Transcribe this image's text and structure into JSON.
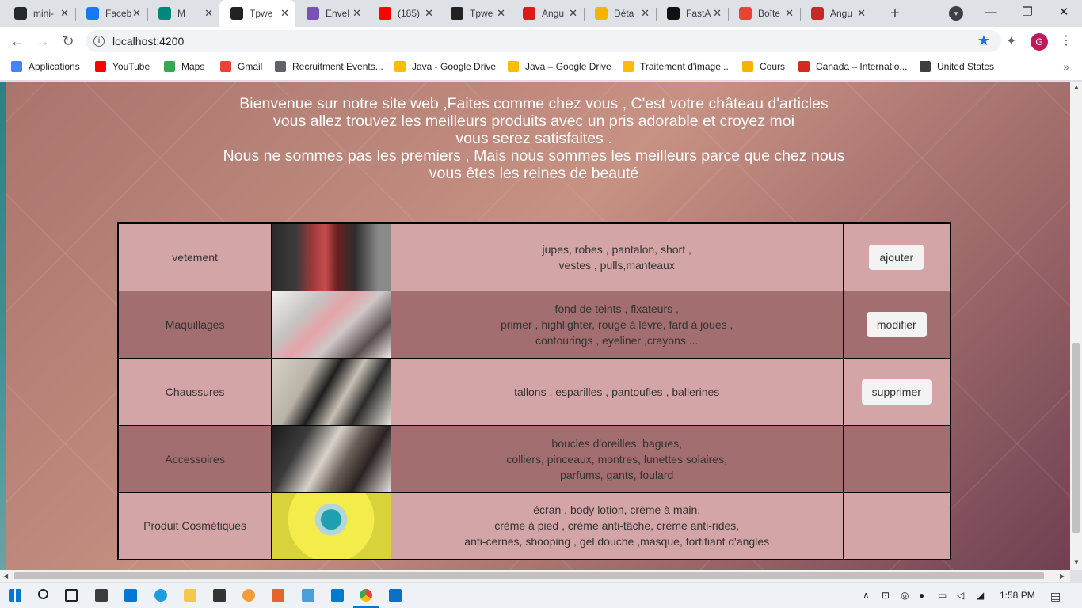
{
  "browser": {
    "tabs": [
      {
        "title": "mini-",
        "icon": "github-icon",
        "color": "#24292e"
      },
      {
        "title": "Faceb",
        "icon": "facebook-icon",
        "color": "#1877f2"
      },
      {
        "title": "M",
        "icon": "meet-icon",
        "color": "#00897b"
      },
      {
        "title": "Tpwe",
        "icon": "angular-icon",
        "color": "#222222"
      },
      {
        "title": "Envel",
        "icon": "bootstrap-icon",
        "color": "#7952b3"
      },
      {
        "title": "(185)",
        "icon": "youtube-icon",
        "color": "#ff0000"
      },
      {
        "title": "Tpwe",
        "icon": "angular-icon",
        "color": "#222222"
      },
      {
        "title": "Angu",
        "icon": "angular-red-icon",
        "color": "#dd1b16"
      },
      {
        "title": "Déta",
        "icon": "classroom-icon",
        "color": "#f4b400"
      },
      {
        "title": "FastA",
        "icon": "fastapi-icon",
        "color": "#111111"
      },
      {
        "title": "Boîte",
        "icon": "gmail-icon",
        "color": "#ea4335"
      },
      {
        "title": "Angu",
        "icon": "j-icon",
        "color": "#c62828"
      }
    ],
    "active_tab_index": 3,
    "url": "localhost:4200",
    "profile_initial": "G",
    "bookmarks": [
      {
        "label": "Applications",
        "icon": "apps-grid-icon",
        "color": "#4285f4"
      },
      {
        "label": "YouTube",
        "icon": "youtube-icon",
        "color": "#ff0000"
      },
      {
        "label": "Maps",
        "icon": "maps-icon",
        "color": "#34a853"
      },
      {
        "label": "Gmail",
        "icon": "gmail-icon",
        "color": "#ea4335"
      },
      {
        "label": "Recruitment Events...",
        "icon": "globe-icon",
        "color": "#5f6368"
      },
      {
        "label": "Java - Google Drive",
        "icon": "drive-icon",
        "color": "#fbbc04"
      },
      {
        "label": "Java – Google Drive",
        "icon": "drive-icon",
        "color": "#fbbc04"
      },
      {
        "label": "Traitement d'image...",
        "icon": "drive-icon",
        "color": "#fbbc04"
      },
      {
        "label": "Cours",
        "icon": "classroom-icon",
        "color": "#f4b400"
      },
      {
        "label": "Canada – Internatio...",
        "icon": "canada-flag-icon",
        "color": "#d52b1e"
      },
      {
        "label": "United States",
        "icon": "person-icon",
        "color": "#3c4043"
      }
    ]
  },
  "page": {
    "welcome_lines": [
      "Bienvenue sur notre site web ,Faites comme chez vous , C'est votre château d'articles",
      "vous allez trouvez les meilleurs produits avec un pris adorable et croyez moi",
      "vous serez satisfaites .",
      "Nous ne sommes pas les premiers , Mais nous sommes les meilleurs parce que chez nous",
      "vous êtes les reines de beauté"
    ],
    "products": [
      {
        "name": "vetement",
        "image": "clothes-rack-photo",
        "desc": [
          "jupes, robes , pantalon, short ,",
          "vestes , pulls,manteaux"
        ],
        "action": "ajouter"
      },
      {
        "name": "Maquillages",
        "image": "makeup-palette-photo",
        "desc": [
          "fond de teints , fixateurs ,",
          "primer , highlighter, rouge à lèvre, fard à joues ,",
          "contourings , eyeliner ,crayons ..."
        ],
        "action": "modifier"
      },
      {
        "name": "Chaussures",
        "image": "high-heels-photo",
        "desc": [
          "tallons , esparilles , pantoufles , ballerines"
        ],
        "action": "supprimer"
      },
      {
        "name": "Accessoires",
        "image": "watch-jewelry-photo",
        "desc": [
          "boucles d'oreilles, bagues,",
          "colliers, pinceaux, montres, lunettes solaires,",
          "parfums, gants, foulard"
        ],
        "action": ""
      },
      {
        "name": "Produit Cosmétiques",
        "image": "cosmetic-jar-photo",
        "desc": [
          "écran , body lotion, crème à main,",
          "crème à pied , crème anti-tâche, crème anti-rides,",
          "anti-cernes, shooping , gel douche ,masque, fortifiant d'angles"
        ],
        "action": ""
      }
    ]
  },
  "taskbar": {
    "time": "1:58 PM"
  }
}
